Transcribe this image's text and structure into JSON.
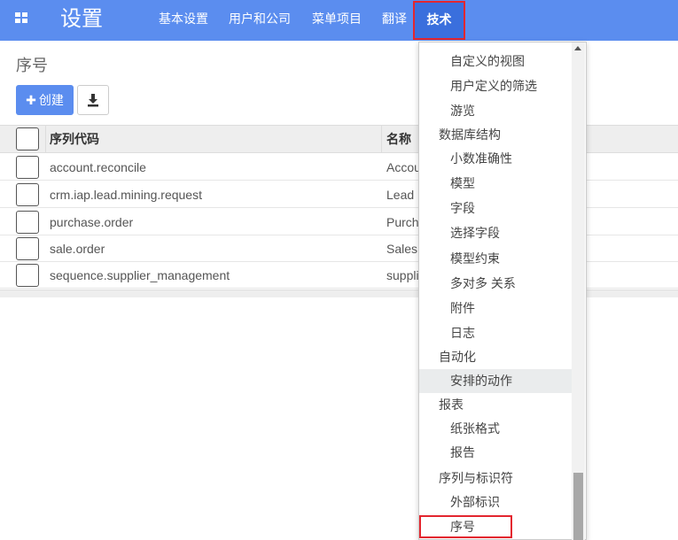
{
  "navbar": {
    "brand": "设置",
    "items": [
      "基本设置",
      "用户和公司",
      "菜单项目",
      "翻译"
    ],
    "active_item": "技术",
    "color": "#5b8def"
  },
  "control_panel": {
    "breadcrumb": "序号",
    "create_label": "创建",
    "create_icon": "plus-icon",
    "download_icon": "download-icon"
  },
  "table": {
    "columns": [
      "序列代码",
      "名称"
    ],
    "rows": [
      {
        "code": "account.reconcile",
        "name": "Accou"
      },
      {
        "code": "crm.iap.lead.mining.request",
        "name": "Lead"
      },
      {
        "code": "purchase.order",
        "name": "Purch"
      },
      {
        "code": "sale.order",
        "name": "Sales"
      },
      {
        "code": "sequence.supplier_management",
        "name": "suppli"
      }
    ]
  },
  "dropdown": {
    "items": [
      {
        "label": "自定义的视图",
        "type": "sub"
      },
      {
        "label": "用户定义的筛选",
        "type": "sub"
      },
      {
        "label": "游览",
        "type": "sub"
      },
      {
        "label": "数据库结构",
        "type": "header"
      },
      {
        "label": "小数准确性",
        "type": "sub"
      },
      {
        "label": "模型",
        "type": "sub"
      },
      {
        "label": "字段",
        "type": "sub"
      },
      {
        "label": "选择字段",
        "type": "sub"
      },
      {
        "label": "模型约束",
        "type": "sub"
      },
      {
        "label": "多对多 关系",
        "type": "sub"
      },
      {
        "label": "附件",
        "type": "sub"
      },
      {
        "label": "日志",
        "type": "sub"
      },
      {
        "label": "自动化",
        "type": "header"
      },
      {
        "label": "安排的动作",
        "type": "sub",
        "active": true
      },
      {
        "label": "报表",
        "type": "header"
      },
      {
        "label": "纸张格式",
        "type": "sub"
      },
      {
        "label": "报告",
        "type": "sub"
      },
      {
        "label": "序列与标识符",
        "type": "header"
      },
      {
        "label": "外部标识",
        "type": "sub"
      },
      {
        "label": "序号",
        "type": "sub",
        "highlighted": true
      }
    ]
  }
}
